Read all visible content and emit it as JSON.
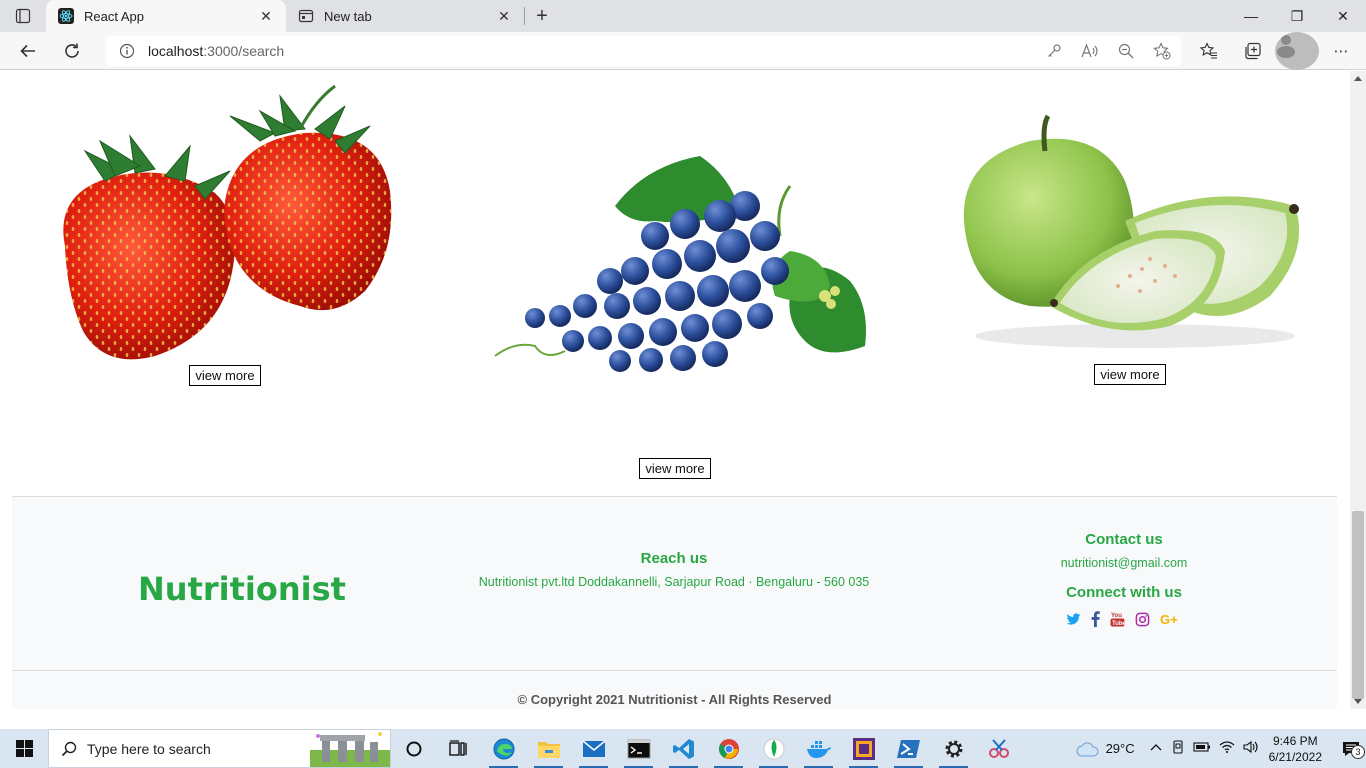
{
  "browser": {
    "tabs": [
      {
        "title": "React App",
        "active": true,
        "icon": "react-icon"
      },
      {
        "title": "New tab",
        "active": false,
        "icon": "new-tab-page-icon"
      }
    ],
    "new_tab_label": "+",
    "url_host": "localhost",
    "url_path": ":3000/search"
  },
  "products": [
    {
      "name": "strawberry",
      "button": "view more"
    },
    {
      "name": "grapes",
      "button": "view more"
    },
    {
      "name": "guava",
      "button": "view more"
    }
  ],
  "footer": {
    "brand": "Nutritionist",
    "reach_title": "Reach us",
    "reach_address": "Nutritionist pvt.ltd Doddakannelli, Sarjapur Road · Bengaluru - 560 035",
    "contact_title": "Contact us",
    "contact_email": "nutritionist@gmail.com",
    "connect_title": "Connect with us",
    "social": [
      {
        "icon": "twitter-icon",
        "color": "#1da1f2"
      },
      {
        "icon": "facebook-icon",
        "color": "#3b5998"
      },
      {
        "icon": "youtube-icon",
        "color": "#c4302b"
      },
      {
        "icon": "instagram-icon",
        "color": "#ac2bac"
      },
      {
        "icon": "google-plus-icon",
        "color": "#f4b400"
      }
    ],
    "copyright": "© Copyright 2021 Nutritionist - All Rights Reserved"
  },
  "colors": {
    "accent": "#28a745"
  },
  "taskbar": {
    "search_placeholder": "Type here to search",
    "temperature": "29°C",
    "time": "9:46 PM",
    "date": "6/21/2022",
    "notification_count": "3"
  }
}
